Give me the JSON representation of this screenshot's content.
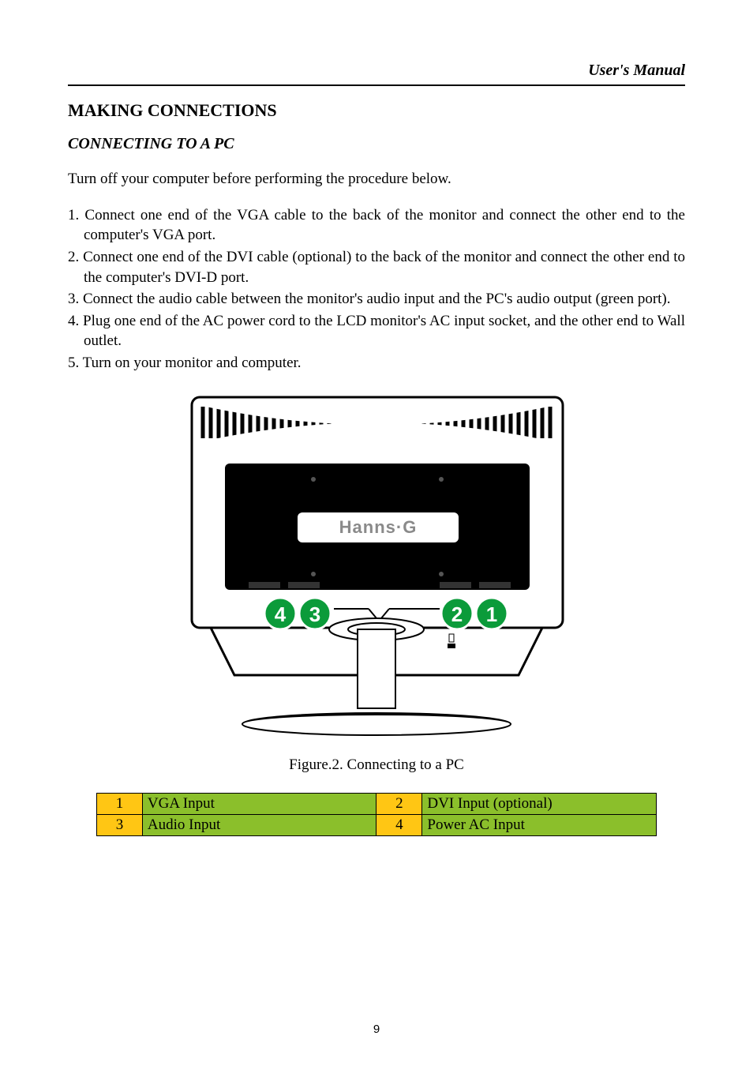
{
  "header": {
    "right_text": "User's Manual"
  },
  "section": {
    "title": "MAKING CONNECTIONS",
    "subtitle": "CONNECTING TO A PC",
    "intro": "Turn off your computer before performing the procedure below.",
    "steps": [
      "1. Connect one end of the VGA cable to the back of the monitor and connect the other end to the computer's VGA port.",
      "2. Connect one end of the DVI cable (optional) to the back of the monitor and connect the other end to the computer's DVI-D port.",
      "3. Connect the audio cable between the monitor's audio input and the PC's audio output (green port).",
      "4. Plug one end of the AC power cord to the LCD monitor's AC input socket, and the other end to Wall outlet.",
      "5. Turn on your monitor and computer."
    ],
    "caption": "Figure.2. Connecting to a PC",
    "table": {
      "r1c1_num": "1",
      "r1c1_lab": "VGA Input",
      "r1c2_num": "2",
      "r1c2_lab": "DVI Input (optional)",
      "r2c1_num": "3",
      "r2c1_lab": "Audio Input",
      "r2c2_num": "4",
      "r2c2_lab": "Power AC Input"
    }
  },
  "figure": {
    "brand_text": "Hanns·G",
    "circle_labels": [
      "4",
      "3",
      "2",
      "1"
    ]
  },
  "page_number": "9"
}
